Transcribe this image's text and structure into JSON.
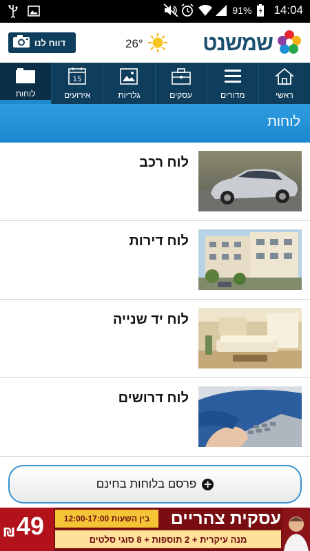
{
  "status_bar": {
    "time": "14:04",
    "battery_percent": "91%",
    "icons": [
      "usb-icon",
      "image-icon",
      "mute-icon",
      "alarm-icon",
      "wifi-icon",
      "signal-icon",
      "battery-icon"
    ]
  },
  "header": {
    "report_button_label": "דווח לנו",
    "weather_temp": "26°",
    "logo_text": "שמשנט",
    "brand_color": "#0f3d5c"
  },
  "nav": {
    "tabs": [
      {
        "label": "ראשי",
        "icon": "home-icon"
      },
      {
        "label": "מדורים",
        "icon": "menu-lines-icon"
      },
      {
        "label": "עסקים",
        "icon": "briefcase-icon"
      },
      {
        "label": "גלריות",
        "icon": "gallery-icon"
      },
      {
        "label": "אירועים",
        "icon": "calendar-icon",
        "calendar_day": "15"
      },
      {
        "label": "לוחות",
        "icon": "board-icon",
        "active": true
      }
    ]
  },
  "section": {
    "title": "לוחות",
    "accent_color": "#1d8ad2"
  },
  "boards": [
    {
      "title": "לוח רכב",
      "thumbnail": "car-photo"
    },
    {
      "title": "לוח דירות",
      "thumbnail": "apartments-photo"
    },
    {
      "title": "לוח יד שנייה",
      "thumbnail": "living-room-photo"
    },
    {
      "title": "לוח דרושים",
      "thumbnail": "keyboard-photo"
    }
  ],
  "publish_button": {
    "label": "פרסם בלוחות בחינם"
  },
  "ad": {
    "price": "49",
    "currency": "₪",
    "hours": "בין השעות 12:00-17:00",
    "headline": "עסקית צהריים",
    "subline": "מנה עיקרית + 2 תוספות + 8 סוגי סלטים"
  }
}
